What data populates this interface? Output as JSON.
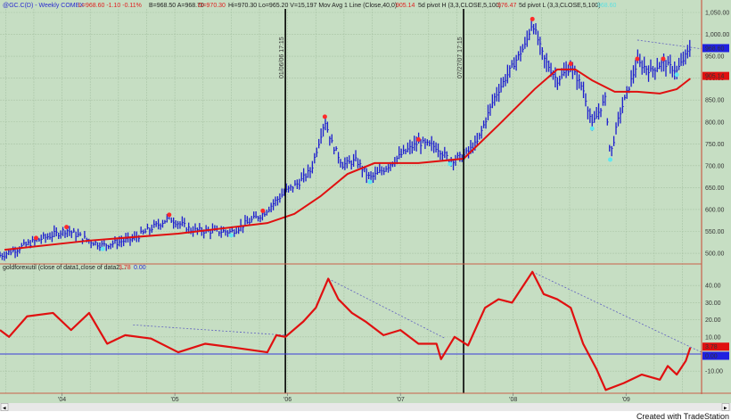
{
  "header": {
    "symbol": "@GC.C(D) - Weekly  COMEX",
    "last": "L=968.60  -1.10  -0.11%",
    "bid_ask": "B=968.50  A=968.70",
    "open": "O=970.30",
    "hilo_vol": "Hi=970.30  Lo=965.20  V=15,197  Mov Avg 1 Line (Close,40,0)",
    "ma_value": "905.14",
    "pivot_h_label": "5d pivot H (3,3,CLOSE,5,100)",
    "pivot_h_value": "976.47",
    "pivot_l_label": "5d pivot L (3,3,CLOSE,5,100)",
    "pivot_l_value": "968.60"
  },
  "lower_header": {
    "label": "goldforexutil (close of data1,close of data2,...",
    "value1": "3.78",
    "value2": "0.00"
  },
  "event_lines": [
    {
      "year": 2005.98,
      "label": "01/06/06 17:15"
    },
    {
      "year": 2007.56,
      "label": "07/27/07 17:15"
    }
  ],
  "footer": {
    "credit": "Created with TradeStation"
  },
  "colors": {
    "background": "#c6dec3",
    "grid": "#a9c4a6",
    "bars": "#1c1ccf",
    "ma": "#e01010",
    "osc": "#e01010",
    "zero": "#3a3ad8",
    "axis_border": "#c9604a"
  },
  "chart_data": [
    {
      "type": "line",
      "title": "@GC.C(D) Weekly price with 40-week moving average",
      "xlim": [
        2003.45,
        2009.67
      ],
      "ylim": [
        490,
        1070
      ],
      "yticks": [
        "1,050.00",
        "1,000.00",
        "950.00",
        "900.00",
        "850.00",
        "800.00",
        "750.00",
        "700.00",
        "650.00",
        "600.00",
        "550.00",
        "500.00"
      ],
      "ytick_values": [
        1050,
        1000,
        950,
        900,
        850,
        800,
        750,
        700,
        650,
        600,
        550,
        500
      ],
      "last_price_label": "968.60",
      "ma_label": "905.14",
      "grid": true,
      "series": [
        {
          "name": "Price (weekly bars)",
          "points": [
            [
              2003.45,
              495
            ],
            [
              2003.49,
              498
            ],
            [
              2003.77,
              529
            ],
            [
              2004.04,
              553
            ],
            [
              2004.24,
              529
            ],
            [
              2004.36,
              518
            ],
            [
              2004.63,
              533
            ],
            [
              2004.95,
              580
            ],
            [
              2005.15,
              553
            ],
            [
              2005.5,
              549
            ],
            [
              2005.78,
              590
            ],
            [
              2005.98,
              641
            ],
            [
              2006.1,
              661
            ],
            [
              2006.21,
              691
            ],
            [
              2006.33,
              804
            ],
            [
              2006.39,
              753
            ],
            [
              2006.49,
              702
            ],
            [
              2006.61,
              712
            ],
            [
              2006.73,
              671
            ],
            [
              2006.85,
              691
            ],
            [
              2007.04,
              732
            ],
            [
              2007.16,
              753
            ],
            [
              2007.32,
              743
            ],
            [
              2007.44,
              712
            ],
            [
              2007.56,
              722
            ],
            [
              2007.68,
              753
            ],
            [
              2007.83,
              854
            ],
            [
              2007.99,
              926
            ],
            [
              2008.11,
              977
            ],
            [
              2008.17,
              1028
            ],
            [
              2008.27,
              946
            ],
            [
              2008.39,
              895
            ],
            [
              2008.51,
              926
            ],
            [
              2008.62,
              875
            ],
            [
              2008.7,
              793
            ],
            [
              2008.82,
              854
            ],
            [
              2008.86,
              722
            ],
            [
              2008.94,
              814
            ],
            [
              2009.1,
              936
            ],
            [
              2009.22,
              916
            ],
            [
              2009.33,
              936
            ],
            [
              2009.45,
              916
            ],
            [
              2009.57,
              968.6
            ]
          ]
        },
        {
          "name": "Mov Avg (Close,40)",
          "points": [
            [
              2003.49,
              508
            ],
            [
              2004.24,
              529
            ],
            [
              2005.03,
              545
            ],
            [
              2005.82,
              569
            ],
            [
              2006.06,
              590
            ],
            [
              2006.29,
              630
            ],
            [
              2006.53,
              681
            ],
            [
              2006.77,
              706
            ],
            [
              2007.16,
              706
            ],
            [
              2007.56,
              716
            ],
            [
              2007.87,
              793
            ],
            [
              2008.19,
              875
            ],
            [
              2008.39,
              920
            ],
            [
              2008.55,
              920
            ],
            [
              2008.7,
              895
            ],
            [
              2008.9,
              869
            ],
            [
              2009.1,
              869
            ],
            [
              2009.3,
              865
            ],
            [
              2009.45,
              875
            ],
            [
              2009.57,
              899
            ]
          ]
        }
      ],
      "trendlines": [
        {
          "from": [
            2009.1,
            987
          ],
          "to": [
            2009.67,
            967
          ]
        }
      ],
      "pivot_highs": [
        [
          2003.77,
          535
        ],
        [
          2004.04,
          560
        ],
        [
          2004.95,
          588
        ],
        [
          2005.78,
          597
        ],
        [
          2006.33,
          812
        ],
        [
          2007.16,
          760
        ],
        [
          2008.17,
          1035
        ],
        [
          2008.51,
          933
        ],
        [
          2009.1,
          944
        ],
        [
          2009.33,
          944
        ]
      ],
      "pivot_lows": [
        [
          2004.36,
          510
        ],
        [
          2005.5,
          541
        ],
        [
          2006.73,
          663
        ],
        [
          2007.44,
          704
        ],
        [
          2008.7,
          785
        ],
        [
          2008.86,
          714
        ],
        [
          2009.45,
          908
        ]
      ]
    },
    {
      "type": "line",
      "title": "goldforexutil",
      "xlim": [
        2003.45,
        2009.67
      ],
      "ylim": [
        -22,
        50
      ],
      "yticks": [
        "40.00",
        "30.00",
        "20.00",
        "10.00",
        "-10.00"
      ],
      "ytick_values": [
        40,
        30,
        20,
        10,
        -10
      ],
      "value_labels": [
        "3.78",
        "0.00"
      ],
      "xticks": [
        "'04",
        "'05",
        "'06",
        "'07",
        "'08",
        "'09"
      ],
      "xtick_values": [
        2004.0,
        2005.0,
        2006.0,
        2007.0,
        2008.0,
        2009.0
      ],
      "grid": true,
      "series": [
        {
          "name": "goldforexutil",
          "points": [
            [
              2003.45,
              14
            ],
            [
              2003.53,
              10
            ],
            [
              2003.69,
              22
            ],
            [
              2003.92,
              24
            ],
            [
              2004.08,
              14
            ],
            [
              2004.24,
              24
            ],
            [
              2004.4,
              6
            ],
            [
              2004.56,
              11
            ],
            [
              2004.79,
              9
            ],
            [
              2005.03,
              1
            ],
            [
              2005.27,
              6
            ],
            [
              2005.5,
              4
            ],
            [
              2005.82,
              1
            ],
            [
              2005.9,
              11
            ],
            [
              2005.98,
              10
            ],
            [
              2006.14,
              19
            ],
            [
              2006.25,
              27
            ],
            [
              2006.36,
              44
            ],
            [
              2006.45,
              32
            ],
            [
              2006.57,
              24
            ],
            [
              2006.69,
              19
            ],
            [
              2006.85,
              11
            ],
            [
              2007.0,
              14
            ],
            [
              2007.16,
              6
            ],
            [
              2007.32,
              6
            ],
            [
              2007.36,
              -3
            ],
            [
              2007.48,
              10
            ],
            [
              2007.6,
              5
            ],
            [
              2007.75,
              27
            ],
            [
              2007.87,
              32
            ],
            [
              2007.99,
              30
            ],
            [
              2008.17,
              48
            ],
            [
              2008.27,
              35
            ],
            [
              2008.39,
              32
            ],
            [
              2008.51,
              27
            ],
            [
              2008.62,
              6
            ],
            [
              2008.74,
              -9
            ],
            [
              2008.82,
              -21
            ],
            [
              2008.98,
              -17
            ],
            [
              2009.14,
              -12
            ],
            [
              2009.3,
              -15
            ],
            [
              2009.37,
              -7
            ],
            [
              2009.45,
              -12
            ],
            [
              2009.53,
              -4
            ],
            [
              2009.57,
              3.78
            ]
          ]
        },
        {
          "name": "zero line",
          "value": 0
        }
      ],
      "trendlines": [
        {
          "from": [
            2004.63,
            17
          ],
          "to": [
            2005.98,
            11
          ]
        },
        {
          "from": [
            2006.36,
            44
          ],
          "to": [
            2007.4,
            9
          ]
        },
        {
          "from": [
            2008.17,
            48
          ],
          "to": [
            2009.67,
            1
          ]
        }
      ]
    }
  ]
}
